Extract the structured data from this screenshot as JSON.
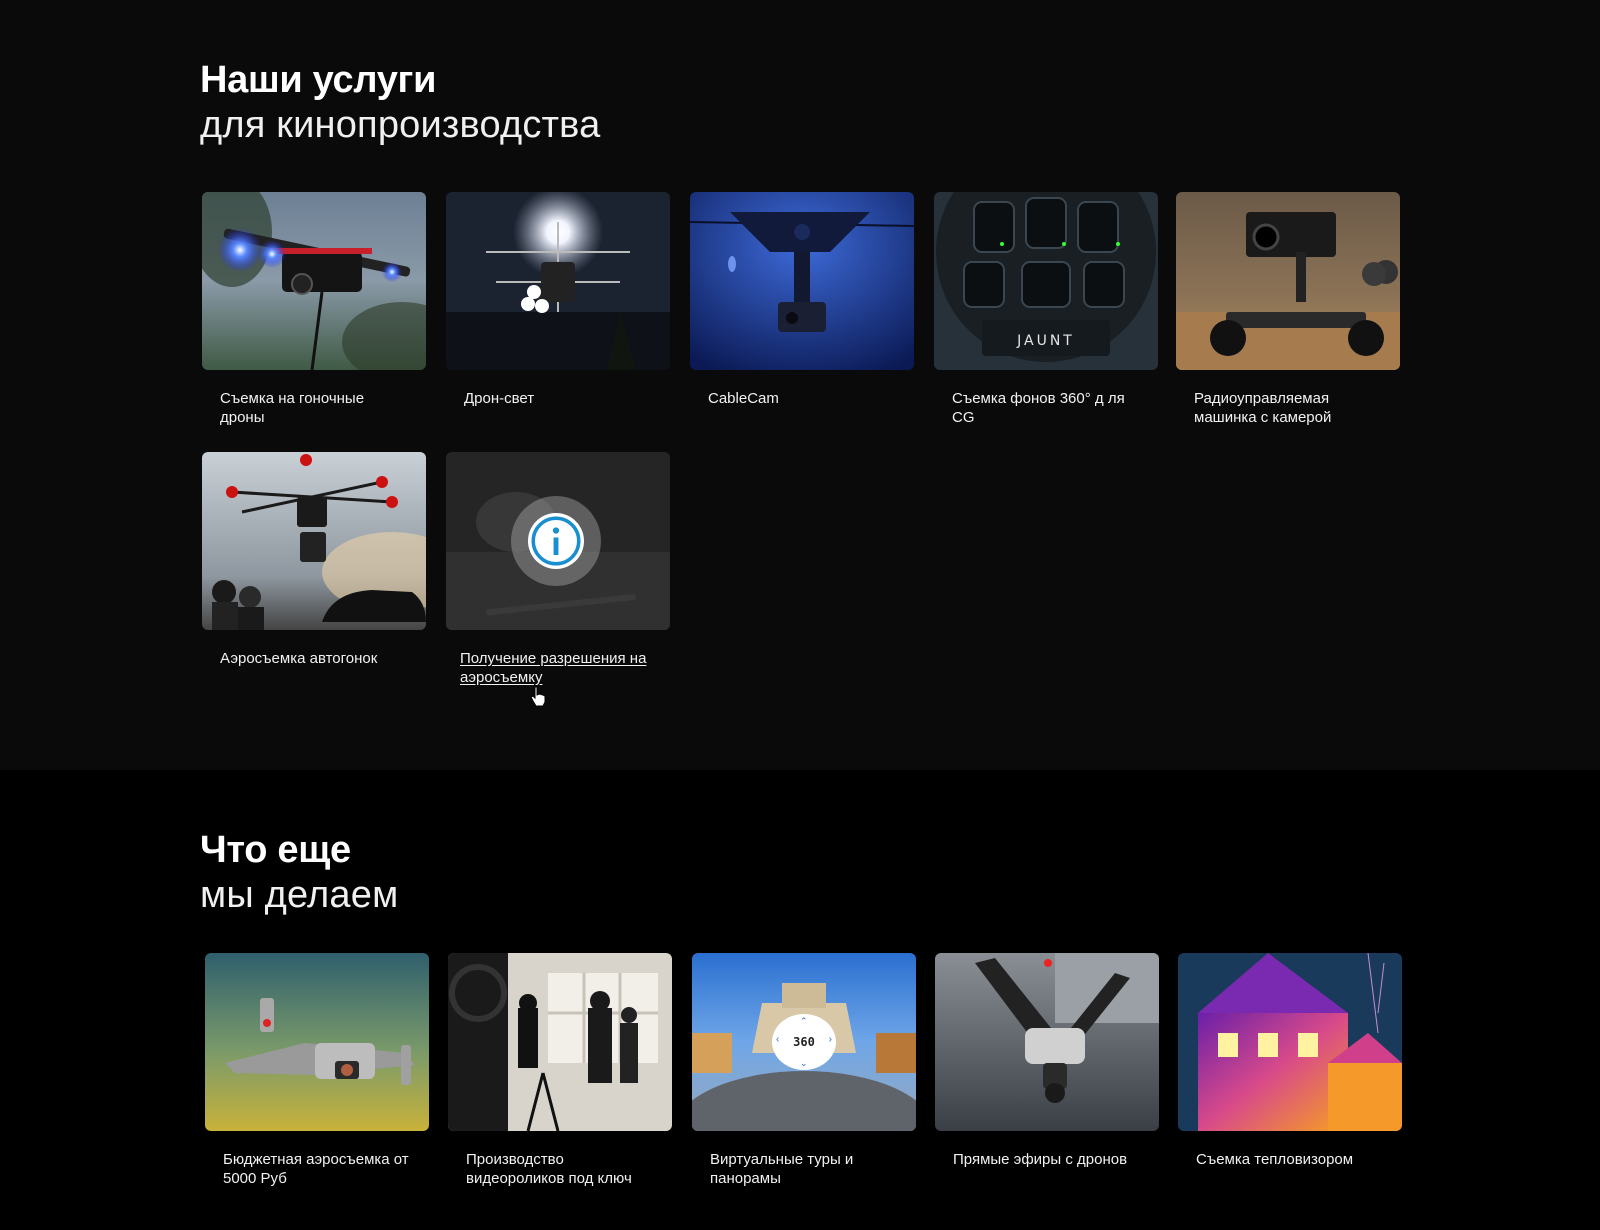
{
  "film_services": {
    "title_bold": "Наши услуги",
    "title_light": "для кинопроизводства",
    "cards": [
      {
        "label": "Съемка на гоночные дроны"
      },
      {
        "label": "Дрон-свет"
      },
      {
        "label": "CableCam"
      },
      {
        "label": "Съемка фонов 360° д ля CG"
      },
      {
        "label": "Радиоуправляемая машинка с камерой"
      },
      {
        "label": "Аэросъемка автогонок"
      },
      {
        "label": "Получение разрешения на аэросъемку"
      }
    ],
    "camera_brand": "JAUNT"
  },
  "more_services": {
    "title_bold": "Что еще",
    "title_light": "мы делаем",
    "cards": [
      {
        "label": "Бюджетная аэросъемка от 5000 Руб"
      },
      {
        "label": "Производство видеороликов под ключ"
      },
      {
        "label": "Виртуальные туры и панорамы"
      },
      {
        "label": "Прямые эфиры с дронов"
      },
      {
        "label": "Съемка тепловизором"
      }
    ],
    "pano_badge": "360"
  },
  "colors": {
    "section1_bg": "#0a0a0a",
    "section2_bg": "#000000",
    "info_icon": "#1a8fd0"
  },
  "icons": [
    "info-icon",
    "hand-cursor-icon"
  ]
}
